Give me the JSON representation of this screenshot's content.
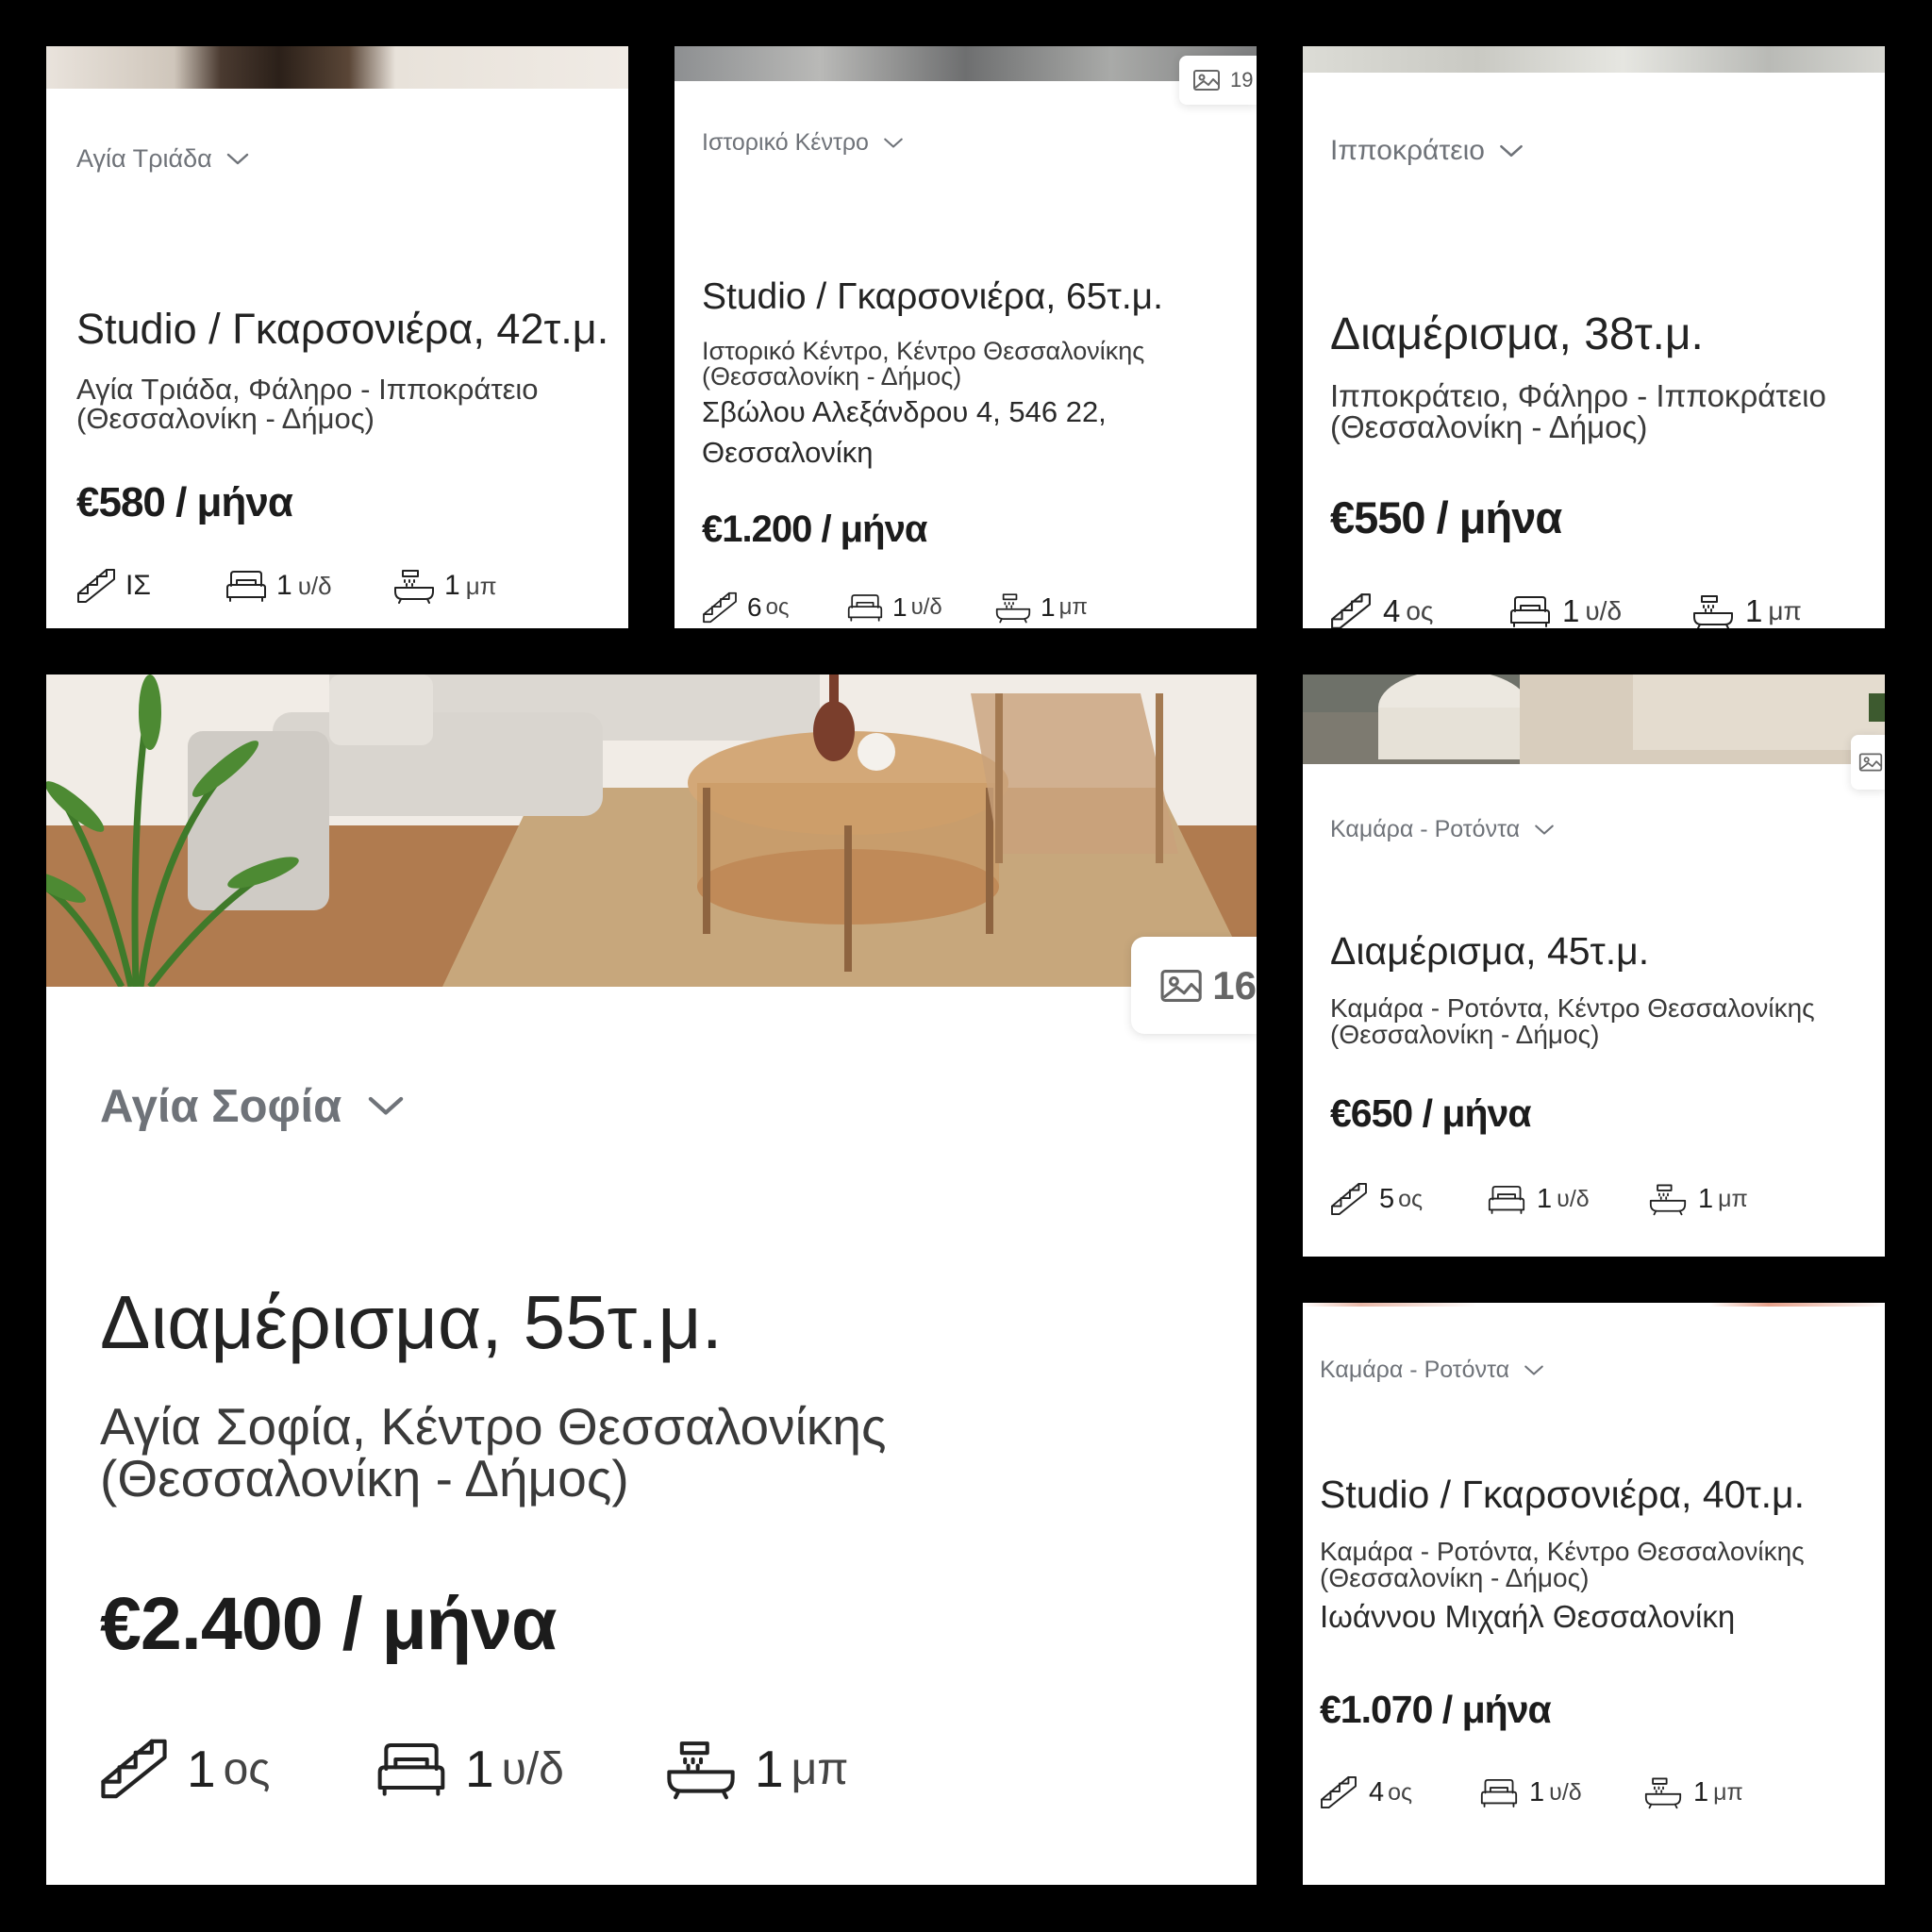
{
  "cards": [
    {
      "area": "Αγία Τριάδα",
      "title": "Studio / Γκαρσονιέρα, 42τ.μ.",
      "location": "Αγία Τριάδα, Φάληρο - Ιπποκράτειο (Θεσσαλονίκη - Δήμος)",
      "price": "€580 / μήνα",
      "floor_value": "ΙΣ",
      "floor_unit": "",
      "bedrooms_value": "1",
      "bedrooms_unit": "υ/δ",
      "bathrooms_value": "1",
      "bathrooms_unit": "μπ"
    },
    {
      "area": "Ιστορικό Κέντρο",
      "photo_count": "19",
      "title": "Studio / Γκαρσονιέρα, 65τ.μ.",
      "location": "Ιστορικό Κέντρο, Κέντρο Θεσσαλονίκης (Θεσσαλονίκη - Δήμος)",
      "address": "Σβώλου Αλεξάνδρου 4, 546 22, Θεσσαλονίκη",
      "price": "€1.200 / μήνα",
      "floor_value": "6",
      "floor_unit": "ος",
      "bedrooms_value": "1",
      "bedrooms_unit": "υ/δ",
      "bathrooms_value": "1",
      "bathrooms_unit": "μπ"
    },
    {
      "area": "Ιπποκράτειο",
      "title": "Διαμέρισμα, 38τ.μ.",
      "location": "Ιπποκράτειο, Φάληρο - Ιπποκράτειο (Θεσσαλονίκη - Δήμος)",
      "price": "€550 / μήνα",
      "floor_value": "4",
      "floor_unit": "ος",
      "bedrooms_value": "1",
      "bedrooms_unit": "υ/δ",
      "bathrooms_value": "1",
      "bathrooms_unit": "μπ"
    },
    {
      "area": "Αγία Σοφία",
      "photo_count": "16",
      "title": "Διαμέρισμα, 55τ.μ.",
      "location": "Αγία Σοφία, Κέντρο Θεσσαλονίκης (Θεσσαλονίκη - Δήμος)",
      "price": "€2.400 / μήνα",
      "floor_value": "1",
      "floor_unit": "ος",
      "bedrooms_value": "1",
      "bedrooms_unit": "υ/δ",
      "bathrooms_value": "1",
      "bathrooms_unit": "μπ"
    },
    {
      "area": "Καμάρα - Ροτόντα",
      "title": "Διαμέρισμα, 45τ.μ.",
      "location": "Καμάρα - Ροτόντα, Κέντρο Θεσσαλονίκης (Θεσσαλονίκη - Δήμος)",
      "price": "€650 / μήνα",
      "floor_value": "5",
      "floor_unit": "ος",
      "bedrooms_value": "1",
      "bedrooms_unit": "υ/δ",
      "bathrooms_value": "1",
      "bathrooms_unit": "μπ"
    },
    {
      "area": "Καμάρα - Ροτόντα",
      "title": "Studio / Γκαρσονιέρα, 40τ.μ.",
      "location": "Καμάρα - Ροτόντα, Κέντρο Θεσσαλονίκης (Θεσσαλονίκη - Δήμος)",
      "address": "Ιωάννου Μιχαήλ Θεσσαλονίκη",
      "price": "€1.070 / μήνα",
      "floor_value": "4",
      "floor_unit": "ος",
      "bedrooms_value": "1",
      "bedrooms_unit": "υ/δ",
      "bathrooms_value": "1",
      "bathrooms_unit": "μπ"
    }
  ],
  "icons": {
    "floor": "stairs-icon",
    "bedrooms": "bed-icon",
    "bathrooms": "bathtub-icon",
    "photos": "image-icon",
    "expand": "chevron-down-icon"
  },
  "colors": {
    "background": "#000000",
    "card": "#ffffff",
    "area_text": "#6f7379",
    "text": "#1f1f1f"
  }
}
